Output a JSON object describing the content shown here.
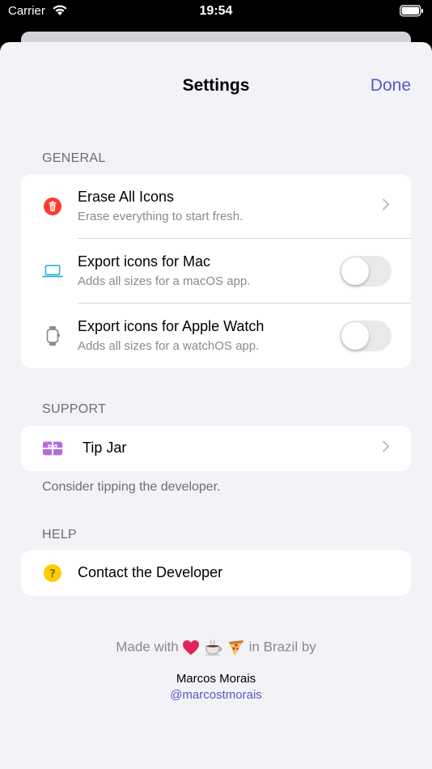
{
  "status_bar": {
    "carrier": "Carrier",
    "time": "19:54"
  },
  "nav": {
    "title": "Settings",
    "done_label": "Done"
  },
  "general": {
    "header": "GENERAL",
    "items": [
      {
        "title": "Erase All Icons",
        "subtitle": "Erase everything to start fresh.",
        "icon": "trash-icon",
        "accessory": "chevron"
      },
      {
        "title": "Export icons for Mac",
        "subtitle": "Adds all sizes for a macOS app.",
        "icon": "laptop-icon",
        "accessory": "toggle",
        "enabled": false
      },
      {
        "title": "Export icons for Apple Watch",
        "subtitle": "Adds all sizes for a watchOS app.",
        "icon": "watch-icon",
        "accessory": "toggle",
        "enabled": false
      }
    ]
  },
  "support": {
    "header": "SUPPORT",
    "tip_jar": {
      "title": "Tip Jar",
      "icon": "gift-icon"
    },
    "footer": "Consider tipping the developer."
  },
  "help": {
    "header": "HELP",
    "contact": {
      "title": "Contact the Developer",
      "icon": "question-icon"
    }
  },
  "credits": {
    "made_with_prefix": "Made with",
    "made_with_suffix": "in Brazil by",
    "emoji": [
      "heart-icon",
      "coffee-icon",
      "pizza-icon"
    ],
    "author": "Marcos Morais",
    "handle": "@marcostmorais"
  },
  "colors": {
    "accent": "#5b57c9",
    "destructive": "#ff3b30",
    "mac_icon": "#34aadc",
    "gift": "#b36bdc",
    "help": "#ffcc00"
  }
}
